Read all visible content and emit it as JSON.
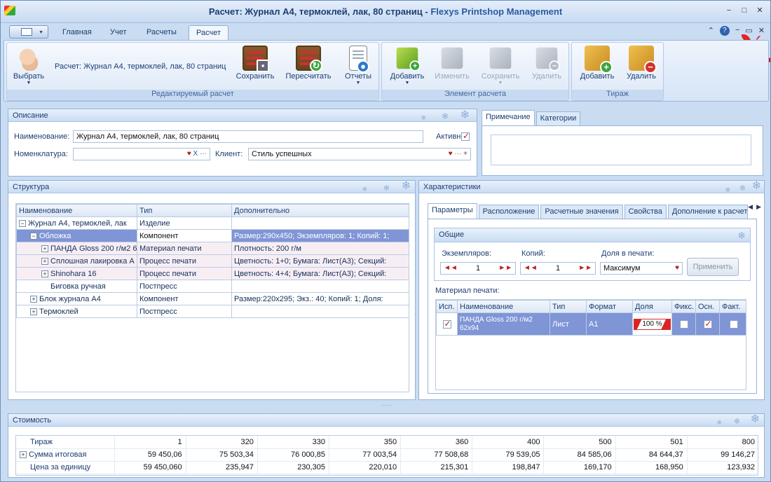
{
  "window": {
    "title_prefix": "Расчет: Журнал А4, термоклей, лак, 80 страниц - ",
    "title_app": "Flexys Printshop Management"
  },
  "ribbon_tabs": [
    "Главная",
    "Учет",
    "Расчеты",
    "Расчет"
  ],
  "ribbon": {
    "select_label": "Выбрать",
    "edited_title": "Расчет: Журнал А4, термоклей, лак, 80 страниц",
    "calc_buttons": {
      "save": "Сохранить",
      "recalc": "Пересчитать",
      "reports": "Отчеты"
    },
    "group_edited": "Редактируемый расчет",
    "element_buttons": {
      "add": "Добавить",
      "edit": "Изменить",
      "save": "Сохранить",
      "delete": "Удалить"
    },
    "group_element": "Элемент расчета",
    "run_buttons": {
      "add": "Добавить",
      "delete": "Удалить"
    },
    "group_run": "Тираж"
  },
  "description": {
    "header": "Описание",
    "name_label": "Наименование:",
    "name_value": "Журнал А4, термоклей, лак, 80 страниц",
    "active_label": "Активно",
    "nomenclature_label": "Номенклатура:",
    "nomenclature_value": "",
    "client_label": "Клиент:",
    "client_value": "Стиль успешных"
  },
  "notes_tabs": [
    "Примечание",
    "Категории"
  ],
  "structure": {
    "header": "Структура",
    "columns": [
      "Наименование",
      "Тип",
      "Дополнительно"
    ],
    "rows": [
      {
        "name": "Журнал А4, термоклей, лак",
        "type": "Изделие",
        "extra": "",
        "level": 0,
        "tog": "−"
      },
      {
        "name": "Обложка",
        "type": "Компонент",
        "extra": "Размер:290x450; Экземпляров: 1; Копий: 1;",
        "level": 1,
        "tog": "−"
      },
      {
        "name": "ПАНДА Gloss 200 г/м2 6",
        "type": "Материал печати",
        "extra": "Плотность: 200 г/м",
        "level": 2,
        "tog": "+"
      },
      {
        "name": "Сплошная лакировка А",
        "type": "Процесс печати",
        "extra": "Цветность: 1+0; Бумага: Лист(А3); Секций:",
        "level": 2,
        "tog": "+"
      },
      {
        "name": "Shinohara 16",
        "type": "Процесс печати",
        "extra": "Цветность: 4+4; Бумага: Лист(А3); Секций:",
        "level": 2,
        "tog": "+"
      },
      {
        "name": "Биговка ручная",
        "type": "Постпресс",
        "extra": "",
        "level": 2,
        "tog": ""
      },
      {
        "name": "Блок журнала А4",
        "type": "Компонент",
        "extra": "Размер:220x295; Экз.: 40; Копий: 1; Доля:",
        "level": 1,
        "tog": "+"
      },
      {
        "name": "Термоклей",
        "type": "Постпресс",
        "extra": "",
        "level": 1,
        "tog": "+"
      }
    ]
  },
  "characteristics": {
    "header": "Характеристики",
    "tabs": [
      "Параметры",
      "Расположение",
      "Расчетные значения",
      "Свойства",
      "Дополнение к расчет"
    ],
    "general_header": "Общие",
    "copies_label": "Экземпляров:",
    "copies_value": "1",
    "kopii_label": "Копий:",
    "kopii_value": "1",
    "share_label": "Доля в печати:",
    "share_value": "Максимум",
    "apply_button": "Применить",
    "material_label": "Материал печати:",
    "material_columns": [
      "Исп.",
      "Наименование",
      "Тип",
      "Формат",
      "Доля",
      "Фикс.",
      "Осн.",
      "Факт."
    ],
    "material_row": {
      "name": "ПАНДА Gloss 200 г/м2 62x94",
      "type": "Лист",
      "format": "A1",
      "share": "100 %"
    }
  },
  "cost": {
    "header": "Стоимость",
    "rows": [
      {
        "label": "Тираж",
        "values": [
          "1",
          "320",
          "330",
          "350",
          "360",
          "400",
          "500",
          "501",
          "800"
        ]
      },
      {
        "label": "Сумма итоговая",
        "values": [
          "59 450,06",
          "75 503,34",
          "76 000,85",
          "77 003,54",
          "77 508,68",
          "79 539,05",
          "84 585,06",
          "84 644,37",
          "99 146,27"
        ]
      },
      {
        "label": "Цена за единицу",
        "values": [
          "59 450,060",
          "235,947",
          "230,305",
          "220,010",
          "215,301",
          "198,847",
          "169,170",
          "168,950",
          "123,932"
        ]
      }
    ]
  },
  "icons": [
    "app-icon",
    "hand-icon",
    "abacus-save-icon",
    "abacus-recalc-icon",
    "reports-icon",
    "cube-add-icon",
    "box-add-icon",
    "box-delete-icon",
    "snowflake-icon",
    "ribbon-bow-icon"
  ],
  "colors": {
    "selected_row": "#7f95d6",
    "panel_border": "#95b3db",
    "header_text": "#1d3e72"
  }
}
